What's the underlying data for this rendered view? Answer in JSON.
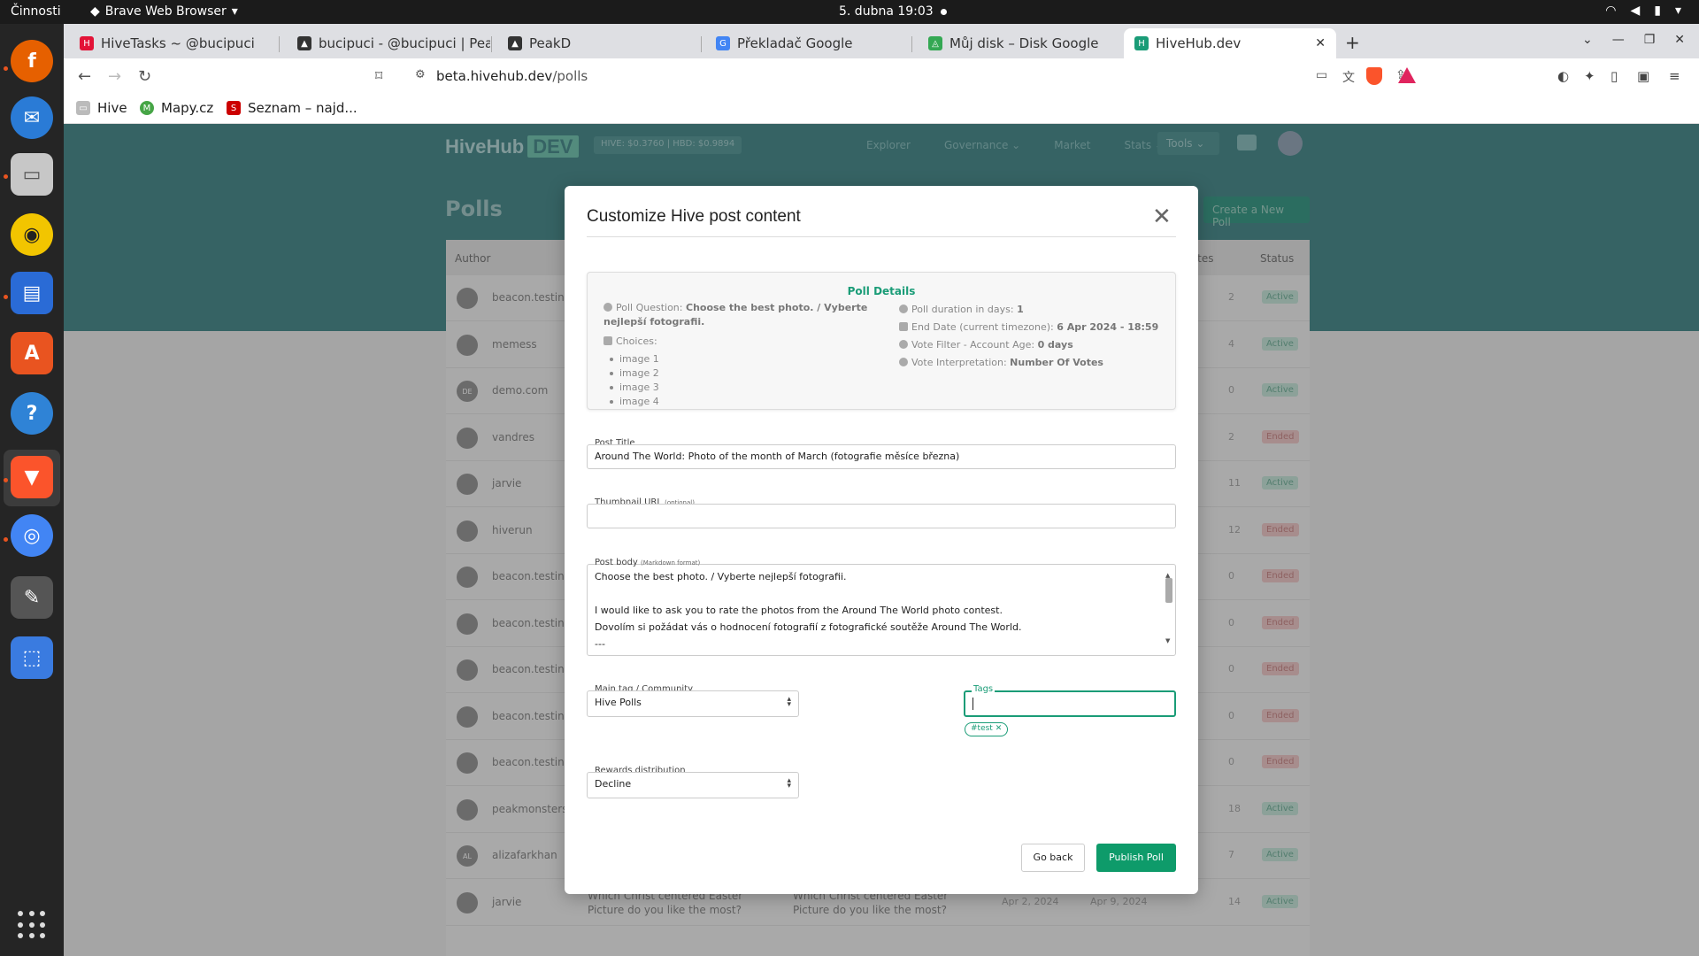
{
  "os": {
    "activities": "Činnosti",
    "app_name": "Brave Web Browser",
    "clock": "5. dubna  19:03"
  },
  "browser": {
    "tabs": [
      {
        "label": "HiveTasks ~ @bucipuci",
        "color": "#e31337"
      },
      {
        "label": "bucipuci - @bucipuci | PeakD",
        "color": "#333333"
      },
      {
        "label": "PeakD",
        "color": "#333333"
      },
      {
        "label": "Překladač Google",
        "color": "#4285f4"
      },
      {
        "label": "Můj disk – Disk Google",
        "color": "#34a853"
      },
      {
        "label": "HiveHub.dev",
        "color": "#1a9c77"
      }
    ],
    "url_host": "beta.hivehub.dev",
    "url_path": "/polls",
    "bookmarks": [
      {
        "label": "Hive"
      },
      {
        "label": "Mapy.cz"
      },
      {
        "label": "Seznam – najd..."
      }
    ],
    "shield_badge": "3",
    "rewards_badge": "1"
  },
  "site": {
    "logo_main": "HiveHub",
    "logo_dev": "DEV",
    "prices": "HIVE: $0.3760  |  HBD: $0.9894",
    "nav": [
      "Explorer",
      "Governance ⌄",
      "Market",
      "Stats ⌄"
    ],
    "tools": "Tools ⌄",
    "page_title": "Polls",
    "create_button": "Create a New Poll",
    "table_headers": {
      "author": "Author",
      "votes": "al Votes",
      "status": "Status"
    },
    "rows": [
      {
        "name": "beacon.testing",
        "votes": "2",
        "status": "Active",
        "avatar": ""
      },
      {
        "name": "memess",
        "votes": "4",
        "status": "Active",
        "avatar": ""
      },
      {
        "name": "demo.com",
        "votes": "0",
        "status": "Active",
        "avatar": "DE"
      },
      {
        "name": "vandres",
        "votes": "2",
        "status": "Ended",
        "avatar": ""
      },
      {
        "name": "jarvie",
        "votes": "11",
        "status": "Active",
        "avatar": ""
      },
      {
        "name": "hiverun",
        "votes": "12",
        "status": "Ended",
        "avatar": ""
      },
      {
        "name": "beacon.testing",
        "votes": "0",
        "status": "Ended",
        "avatar": ""
      },
      {
        "name": "beacon.testing",
        "votes": "0",
        "status": "Ended",
        "avatar": ""
      },
      {
        "name": "beacon.testing",
        "votes": "0",
        "status": "Ended",
        "avatar": ""
      },
      {
        "name": "beacon.testing",
        "votes": "0",
        "status": "Ended",
        "avatar": ""
      },
      {
        "name": "beacon.testing",
        "votes": "0",
        "status": "Ended",
        "avatar": ""
      },
      {
        "name": "peakmonsters",
        "votes": "18",
        "status": "Active",
        "avatar": ""
      },
      {
        "name": "alizafarkhan",
        "votes": "7",
        "status": "Active",
        "avatar": "AL"
      },
      {
        "name": "jarvie",
        "votes": "14",
        "status": "Active",
        "avatar": "",
        "q1": "Which Christ centered Easter Picture do you like the most?",
        "q2": "Which Christ centered Easter Picture do you like the most?",
        "d1": "Apr 2, 2024",
        "d2": "Apr 9, 2024"
      }
    ]
  },
  "modal": {
    "title": "Customize Hive post content",
    "poll_details": {
      "heading": "Poll Details",
      "question_label": "Poll Question:",
      "question": "Choose the best photo. / Vyberte nejlepší fotografii.",
      "choices_label": "Choices:",
      "choices": [
        "image 1",
        "image 2",
        "image 3",
        "image 4"
      ],
      "duration_label": "Poll duration in days:",
      "duration": "1",
      "end_label": "End Date (current timezone):",
      "end": "6 Apr 2024 - 18:59",
      "filter_label": "Vote Filter - Account Age:",
      "filter": "0 days",
      "interp_label": "Vote Interpretation:",
      "interp": "Number Of Votes"
    },
    "post_title_label": "Post Title",
    "post_title": "Around The World: Photo of the month of March (fotografie měsíce března)",
    "thumb_label": "Thumbnail URL",
    "thumb_optional": "(optional)",
    "thumb_value": "",
    "body_label": "Post body",
    "body_hint": "(Markdown format)",
    "body_lines": [
      "Choose the best photo. / Vyberte nejlepší fotografii.",
      "",
      "I would like to ask you to rate the photos from the Around The World photo contest.",
      "Dovolím si požádat vás o hodnocení fotografií z fotografické soutěže Around The World.",
      "---"
    ],
    "main_tag_label": "Main tag / Community",
    "main_tag": "Hive Polls",
    "tags_label": "Tags",
    "tag_chip": "#test",
    "rewards_label": "Rewards distribution",
    "rewards": "Decline",
    "back_button": "Go back",
    "publish_button": "Publish Poll"
  }
}
